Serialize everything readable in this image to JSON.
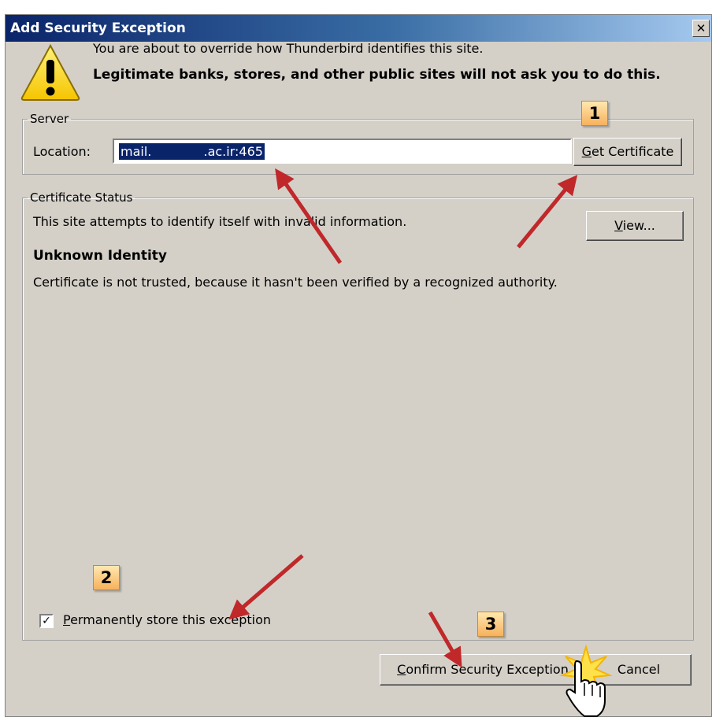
{
  "window": {
    "title": "Add Security Exception",
    "close_glyph": "✕"
  },
  "message": {
    "line1": "You are about to override how Thunderbird identifies this site.",
    "line2": "Legitimate banks, stores, and other public sites will not ask you to do this."
  },
  "server": {
    "legend": "Server",
    "location_label": "Location:",
    "location_value": "mail.             .ac.ir:465",
    "get_certificate_label_access": "G",
    "get_certificate_label_rest": "et Certificate"
  },
  "certificate_status": {
    "legend": "Certificate Status",
    "status_text": "This site attempts to identify itself with invalid information.",
    "view_button_access": "V",
    "view_button_rest": "iew...",
    "identity_title": "Unknown Identity",
    "identity_detail": "Certificate is not trusted, because it hasn't been verified by a recognized authority."
  },
  "permanent": {
    "checked": true,
    "check_glyph": "✓",
    "label_access": "P",
    "label_rest": "ermanently store this exception"
  },
  "buttons": {
    "confirm_access": "C",
    "confirm_rest": "onfirm Security Exception",
    "cancel": "Cancel"
  },
  "annotations": {
    "steps": [
      "1",
      "2",
      "3"
    ],
    "arrow_color": "#c0282a",
    "badge_color": "#f7b15b"
  },
  "icons": [
    "warning-icon",
    "close-icon",
    "hand-cursor-icon"
  ]
}
